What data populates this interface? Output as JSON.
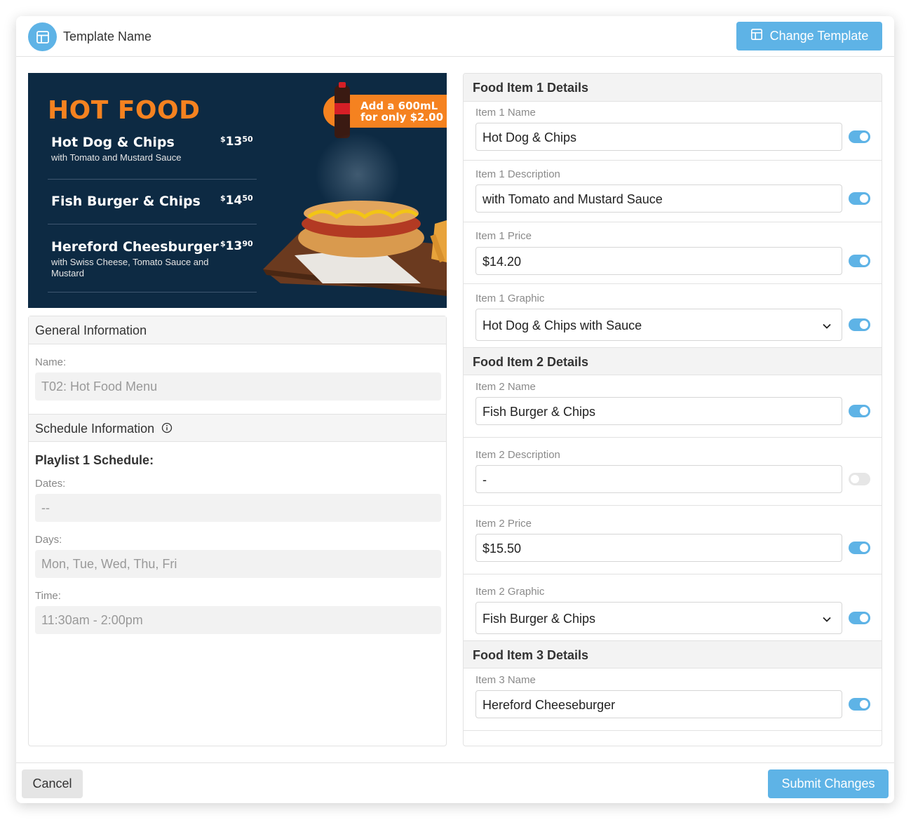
{
  "header": {
    "template_name": "Template Name",
    "change_template_label": "Change Template"
  },
  "preview": {
    "title": "HOT FOOD",
    "promo_line1": "Add a 600mL",
    "promo_line2": "for only $2.00",
    "items": [
      {
        "name": "Hot Dog & Chips",
        "desc": "with Tomato and Mustard Sauce",
        "price_dollars": "13",
        "price_cents": "50"
      },
      {
        "name": "Fish Burger & Chips",
        "desc": "",
        "price_dollars": "14",
        "price_cents": "50"
      },
      {
        "name": "Hereford Cheesburger",
        "desc": "with Swiss Cheese, Tomato Sauce and Mustard",
        "price_dollars": "13",
        "price_cents": "90"
      }
    ],
    "currency": "$"
  },
  "general": {
    "heading": "General Information",
    "name_label": "Name:",
    "name_value": "T02: Hot Food Menu"
  },
  "schedule": {
    "heading": "Schedule Information",
    "playlist_label": "Playlist 1 Schedule:",
    "dates_label": "Dates:",
    "dates_value": "--",
    "days_label": "Days:",
    "days_value": "Mon, Tue, Wed, Thu, Fri",
    "time_label": "Time:",
    "time_value": "11:30am - 2:00pm"
  },
  "food1": {
    "heading": "Food Item 1 Details",
    "name_label": "Item 1 Name",
    "name_value": "Hot Dog & Chips",
    "name_enabled": true,
    "desc_label": "Item 1 Description",
    "desc_value": "with Tomato and Mustard Sauce",
    "desc_enabled": true,
    "price_label": "Item 1 Price",
    "price_value": "$14.20",
    "price_enabled": true,
    "graphic_label": "Item 1 Graphic",
    "graphic_value": "Hot Dog & Chips with Sauce",
    "graphic_enabled": true
  },
  "food2": {
    "heading": "Food Item 2 Details",
    "name_label": "Item 2 Name",
    "name_value": "Fish Burger & Chips",
    "name_enabled": true,
    "desc_label": "Item 2 Description",
    "desc_value": "-",
    "desc_enabled": false,
    "price_label": "Item 2 Price",
    "price_value": "$15.50",
    "price_enabled": true,
    "graphic_label": "Item 2 Graphic",
    "graphic_value": "Fish Burger & Chips",
    "graphic_enabled": true
  },
  "food3": {
    "heading": "Food Item 3 Details",
    "name_label": "Item 3 Name",
    "name_value": "Hereford Cheeseburger",
    "name_enabled": true
  },
  "footer": {
    "cancel_label": "Cancel",
    "submit_label": "Submit Changes"
  },
  "colors": {
    "accent": "#5eb3e6",
    "preview_bg": "#0d2a43",
    "promo_orange": "#f58220"
  },
  "icons": {
    "header_logo": "layout-icon",
    "change_template": "layout-icon",
    "schedule_info": "info-circle-icon",
    "select_arrow": "chevron-down-icon"
  }
}
